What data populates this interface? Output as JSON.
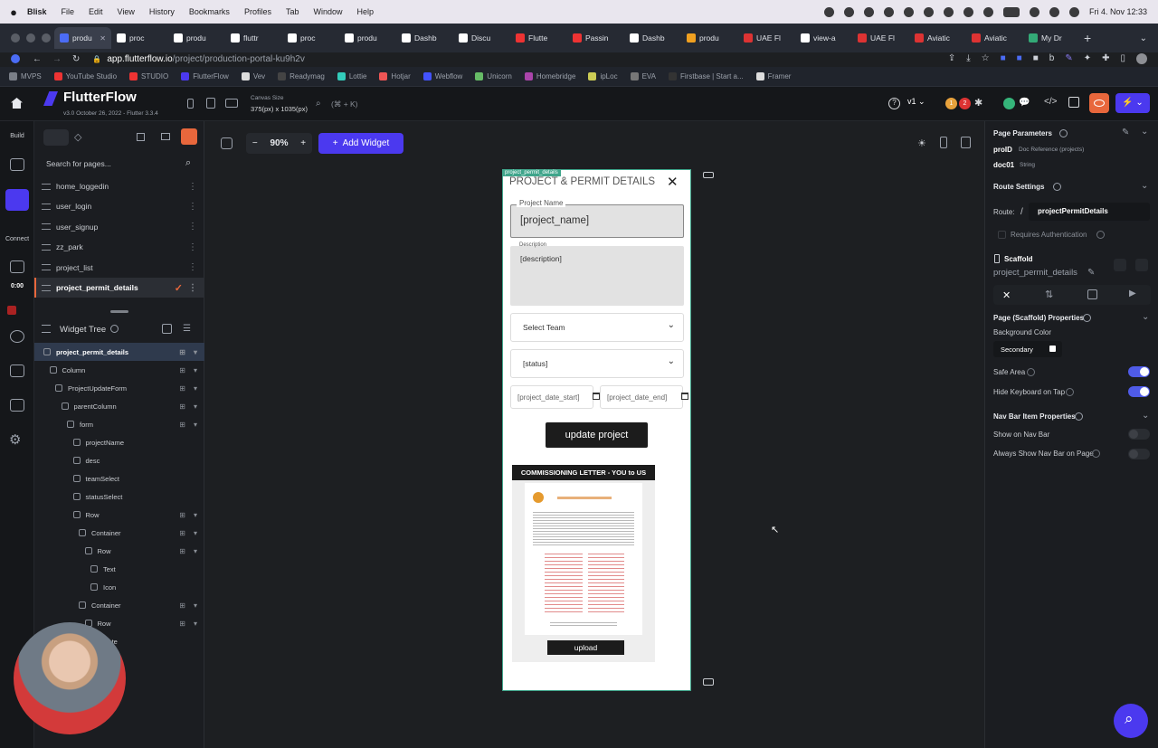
{
  "menubar": {
    "apple": "",
    "items": [
      "Blisk",
      "File",
      "Edit",
      "View",
      "History",
      "Bookmarks",
      "Profiles",
      "Tab",
      "Window",
      "Help"
    ],
    "clock": "Fri 4. Nov 12:33"
  },
  "tabs": [
    {
      "label": "produ",
      "color": "#4b6cf5",
      "active": true
    },
    {
      "label": "proc",
      "color": "#ffffff",
      "active": false
    },
    {
      "label": "produ",
      "color": "#ffffff",
      "active": false
    },
    {
      "label": "fluttr",
      "color": "#ffffff",
      "active": false
    },
    {
      "label": "proc",
      "color": "#ffffff",
      "active": false
    },
    {
      "label": "produ",
      "color": "#ffffff",
      "active": false
    },
    {
      "label": "Dashb",
      "color": "#ffffff",
      "active": false
    },
    {
      "label": "Discu",
      "color": "#ffffff",
      "active": false
    },
    {
      "label": "Flutte",
      "color": "#e33",
      "active": false
    },
    {
      "label": "Passin",
      "color": "#e33",
      "active": false
    },
    {
      "label": "Dashb",
      "color": "#ffffff",
      "active": false
    },
    {
      "label": "produ",
      "color": "#f0a020",
      "active": false
    },
    {
      "label": "UAE Fl",
      "color": "#d33",
      "active": false
    },
    {
      "label": "view-a",
      "color": "#ffffff",
      "active": false
    },
    {
      "label": "UAE Fl",
      "color": "#d33",
      "active": false
    },
    {
      "label": "Aviatic",
      "color": "#d33",
      "active": false
    },
    {
      "label": "Aviatic",
      "color": "#d33",
      "active": false
    },
    {
      "label": "My Dr",
      "color": "#3a7",
      "active": false
    }
  ],
  "address": {
    "host": "app.flutterflow.io",
    "path": "/project/production-portal-ku9h2v"
  },
  "bookmarks": [
    {
      "label": "MVPS",
      "color": "#7a7f88"
    },
    {
      "label": "YouTube Studio",
      "color": "#e33"
    },
    {
      "label": "STUDIO",
      "color": "#e33"
    },
    {
      "label": "FlutterFlow",
      "color": "#4b39ef"
    },
    {
      "label": "Vev",
      "color": "#ddd"
    },
    {
      "label": "Readymag",
      "color": "#444"
    },
    {
      "label": "Lottie",
      "color": "#3cb"
    },
    {
      "label": "Hotjar",
      "color": "#e55"
    },
    {
      "label": "Webflow",
      "color": "#4353ff"
    },
    {
      "label": "Unicorn",
      "color": "#6b6"
    },
    {
      "label": "Homebridge",
      "color": "#a4a"
    },
    {
      "label": "ipLoc",
      "color": "#cc5"
    },
    {
      "label": "EVA",
      "color": "#777"
    },
    {
      "label": "Firstbase | Start a...",
      "color": "#333"
    },
    {
      "label": "Framer",
      "color": "#ddd"
    }
  ],
  "ff": {
    "logo": "FlutterFlow",
    "version": "v3.0 October 26, 2022 - Flutter 3.3.4",
    "canvas_size_label": "Canvas Size",
    "canvas_size_value": "375(px) x 1035(px)",
    "search_shortcut": "(⌘ + K)",
    "version_select": "v1",
    "badge1": "1",
    "badge2": "2"
  },
  "rail": {
    "build": "Build",
    "connect": "Connect",
    "timer": "0:00"
  },
  "pages": {
    "search_placeholder": "Search for pages...",
    "items": [
      {
        "label": "home_loggedin",
        "selected": false
      },
      {
        "label": "user_login",
        "selected": false
      },
      {
        "label": "user_signup",
        "selected": false
      },
      {
        "label": "zz_park",
        "selected": false
      },
      {
        "label": "project_list",
        "selected": false
      },
      {
        "label": "project_permit_details",
        "selected": true
      }
    ]
  },
  "widget_tree": {
    "title": "Widget Tree",
    "items": [
      {
        "label": "project_permit_details",
        "indent": 0,
        "selected": true
      },
      {
        "label": "Column",
        "indent": 1
      },
      {
        "label": "ProjectUpdateForm",
        "indent": 2
      },
      {
        "label": "parentColumn",
        "indent": 3
      },
      {
        "label": "form",
        "indent": 4
      },
      {
        "label": "projectName",
        "indent": 5
      },
      {
        "label": "desc",
        "indent": 5
      },
      {
        "label": "teamSelect",
        "indent": 5
      },
      {
        "label": "statusSelect",
        "indent": 5
      },
      {
        "label": "Row",
        "indent": 5
      },
      {
        "label": "Container",
        "indent": 6
      },
      {
        "label": "Row",
        "indent": 7
      },
      {
        "label": "Text",
        "indent": 8
      },
      {
        "label": "Icon",
        "indent": 8
      },
      {
        "label": "Container",
        "indent": 6
      },
      {
        "label": "Row",
        "indent": 7
      },
      {
        "label": "Date",
        "indent": 8
      }
    ]
  },
  "toolbar": {
    "zoom": "90%",
    "add_widget": "Add Widget"
  },
  "phone": {
    "page_tag": "project_permit_details",
    "title": "PROJECT & PERMIT DETAILS",
    "project_name_label": "Project Name",
    "project_name_value": "[project_name]",
    "description_label": "Description",
    "description_value": "[description]",
    "team_select": "Select Team",
    "status_select": "[status]",
    "date_start": "[project_date_start]",
    "date_end": "[project_date_end]",
    "update_button": "update project",
    "letter_title": "COMMISSIONING LETTER - YOU to US",
    "upload_button": "upload"
  },
  "right": {
    "page_params_title": "Page Parameters",
    "param1_name": "proID",
    "param1_type": "Doc Reference (projects)",
    "param2_name": "doc01",
    "param2_type": "String",
    "route_settings": "Route Settings",
    "route_label": "Route:",
    "route_slash": "/",
    "route_value": "projectPermitDetails",
    "requires_auth": "Requires Authentication",
    "scaffold_label": "Scaffold",
    "scaffold_name": "project_permit_details",
    "scaffold_props": "Page (Scaffold) Properties",
    "bg_color_label": "Background Color",
    "bg_color_value": "Secondary",
    "safe_area": "Safe Area",
    "hide_keyboard": "Hide Keyboard on Tap",
    "nav_bar_props": "Nav Bar Item Properties",
    "show_on_nav": "Show on Nav Bar",
    "always_show_nav": "Always Show Nav Bar on Page"
  },
  "colors": {
    "accent": "#4b39ef",
    "phone_border": "#3fa58b",
    "orange": "#e8673c"
  }
}
